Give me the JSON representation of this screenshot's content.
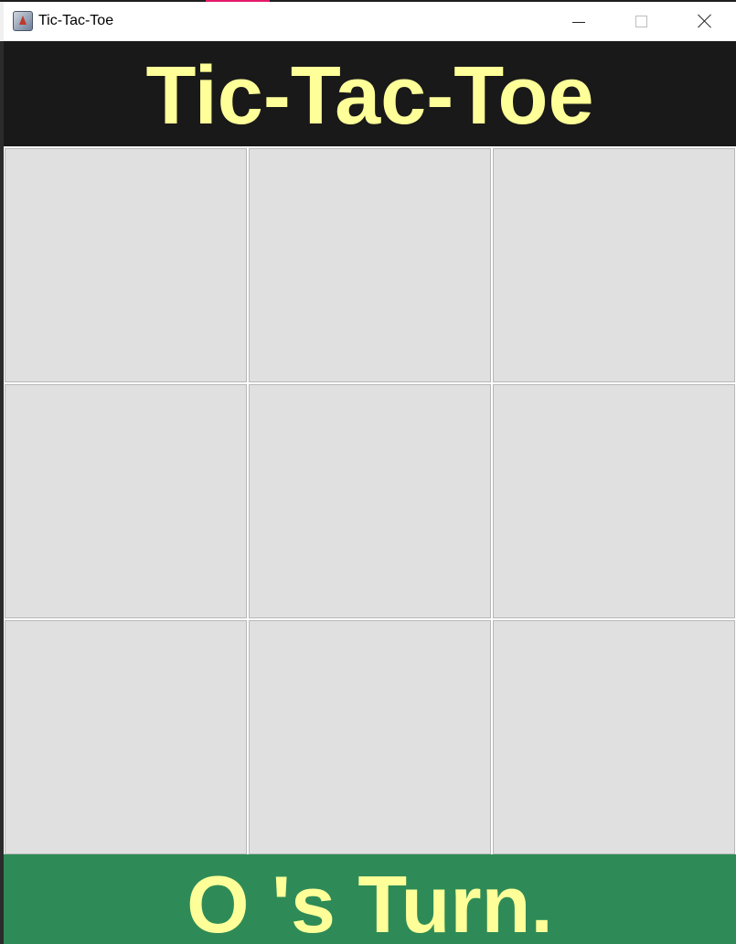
{
  "window": {
    "title": "Tic-Tac-Toe",
    "icon": "java-app-icon",
    "controls": {
      "minimize": "minimize-icon",
      "maximize": "maximize-icon",
      "close": "close-icon"
    }
  },
  "header": {
    "title": "Tic-Tac-Toe",
    "background": "#191919",
    "text_color": "#ffff99"
  },
  "board": {
    "cells": [
      "",
      "",
      "",
      "",
      "",
      "",
      "",
      "",
      ""
    ],
    "cell_background": "#e0e0e0"
  },
  "status": {
    "text": "O 's Turn.",
    "background": "#2e8b57",
    "text_color": "#ffff99"
  }
}
